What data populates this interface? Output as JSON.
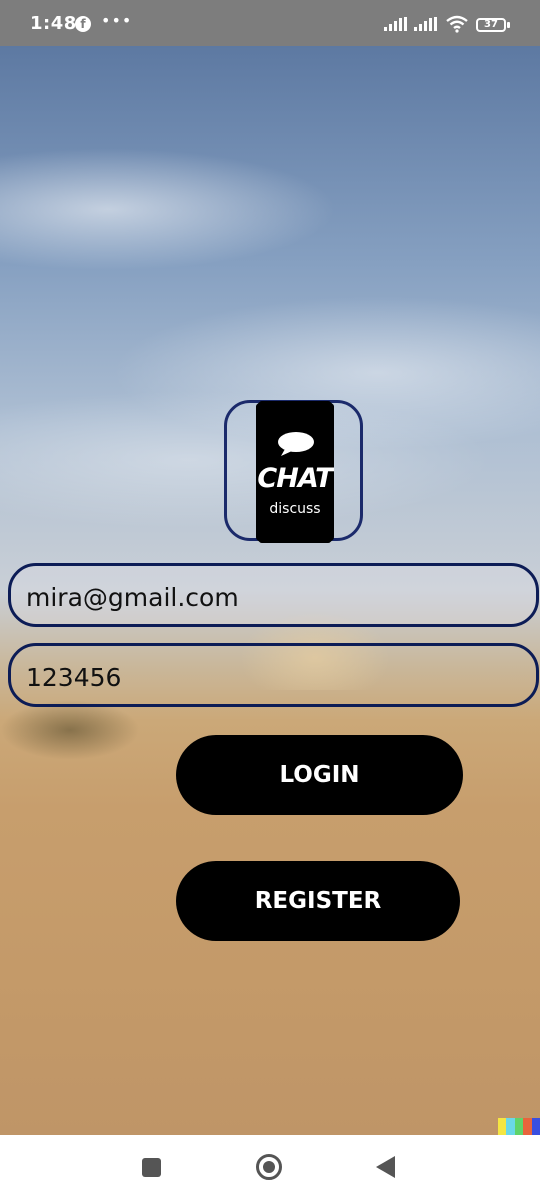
{
  "status_bar": {
    "time": "1:48",
    "battery": "37",
    "icons": [
      "facebook-icon",
      "more-icon",
      "signal-icon",
      "signal-icon",
      "wifi-icon",
      "battery-icon"
    ]
  },
  "logo": {
    "title": "CHAT",
    "subtitle": "discuss"
  },
  "form": {
    "email_value": "mira@gmail.com",
    "password_value": "123456"
  },
  "buttons": {
    "login_label": "LOGIN",
    "register_label": "REGISTER"
  },
  "nav_bar": {
    "icons": [
      "recents-icon",
      "home-icon",
      "back-icon"
    ]
  },
  "colors": {
    "status_bar_bg": "#7d7d7d",
    "input_border": "#0c1c56",
    "logo_frame": "#1b2a6b",
    "button_bg": "#000000",
    "button_text": "#ffffff",
    "strip": [
      "#f5e642",
      "#6ad8e8",
      "#5fd36a",
      "#e8643c",
      "#3a4fe0"
    ]
  }
}
